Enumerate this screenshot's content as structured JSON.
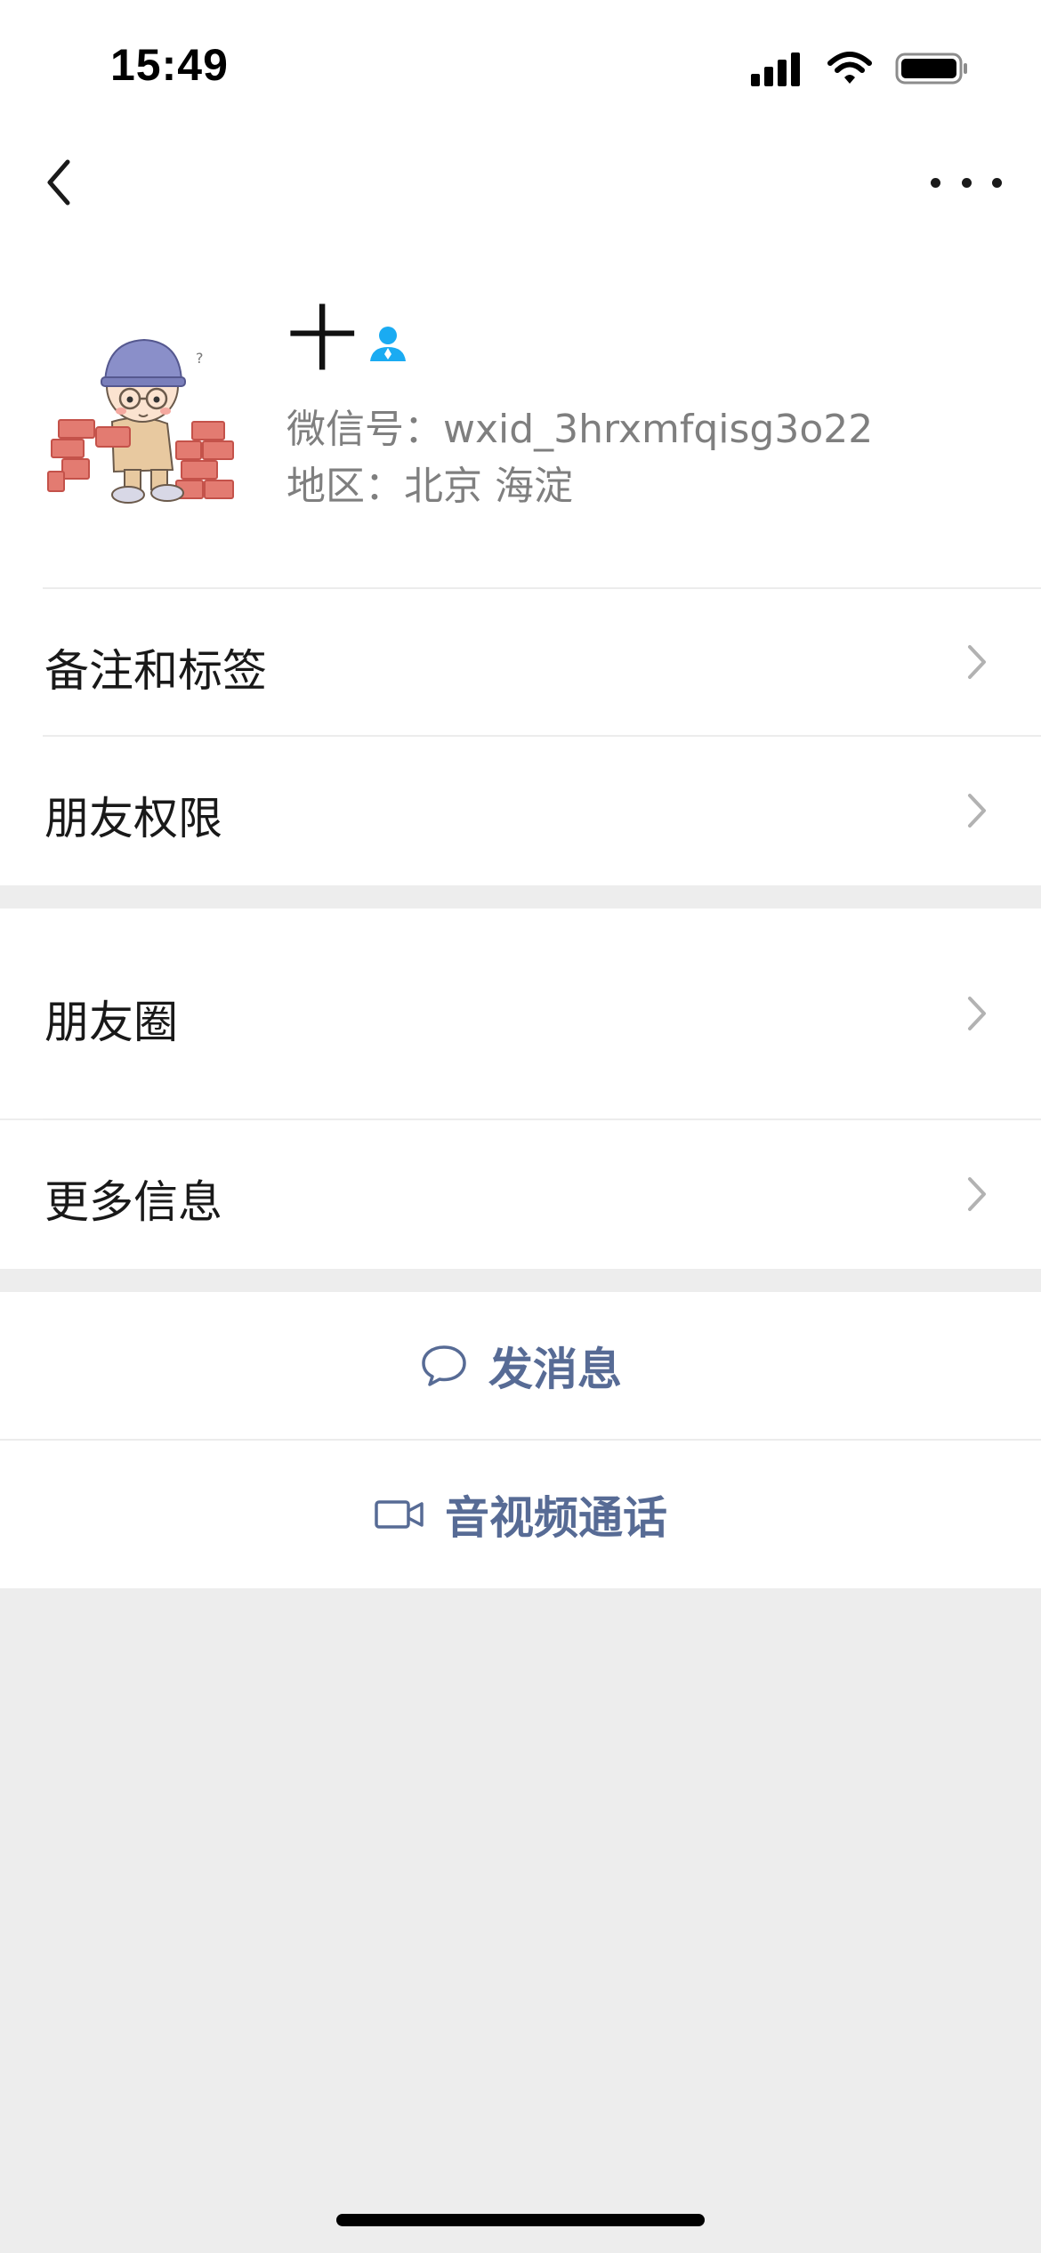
{
  "status_bar": {
    "time": "15:49"
  },
  "profile": {
    "name": "十",
    "wechat_id": "微信号：wxid_3hrxmfqisg3o22",
    "region": "地区：北京 海淀"
  },
  "rows": {
    "notes_tags": "备注和标签",
    "friend_permissions": "朋友权限",
    "moments": "朋友圈",
    "more_info": "更多信息"
  },
  "actions": {
    "send_message": "发消息",
    "av_call": "音视频通话"
  },
  "colors": {
    "accent": "#576b95",
    "background": "#ededed",
    "verified_icon": "#1aabf2"
  }
}
